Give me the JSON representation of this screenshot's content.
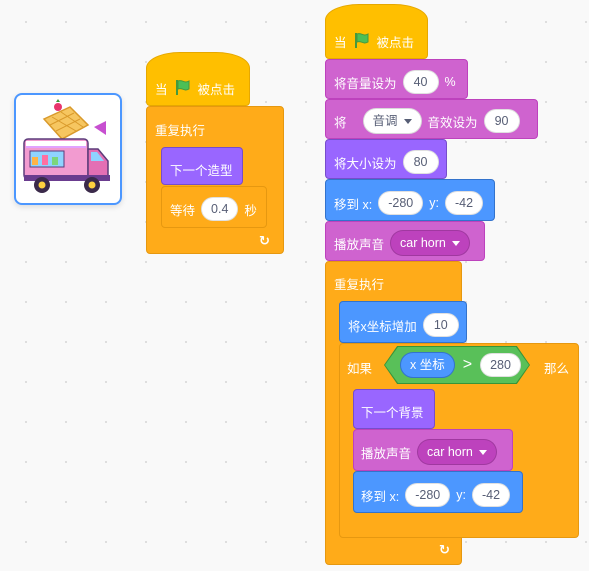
{
  "sprite": {
    "name_icon": "waffle-food-truck"
  },
  "script1": {
    "hat_when": "当",
    "hat_clicked": "被点击",
    "forever": "重复执行",
    "next_costume": "下一个造型",
    "wait_label": "等待",
    "wait_value": "0.4",
    "wait_unit": "秒"
  },
  "script2": {
    "hat_when": "当",
    "hat_clicked": "被点击",
    "set_volume_label": "将音量设为",
    "set_volume_value": "40",
    "set_volume_unit": "%",
    "set_effect_prefix": "将",
    "set_effect_option": "音调",
    "set_effect_label": "音效设为",
    "set_effect_value": "90",
    "set_size_label": "将大小设为",
    "set_size_value": "80",
    "goto_label": "移到 x:",
    "goto_x": "-280",
    "goto_y_label": "y:",
    "goto_y": "-42",
    "play_sound_label": "播放声音",
    "play_sound_option": "car horn",
    "forever": "重复执行",
    "change_x_label": "将x坐标增加",
    "change_x_value": "10",
    "if_label": "如果",
    "x_position": "x 坐标",
    "gt": ">",
    "compare_value": "280",
    "then_label": "那么",
    "next_backdrop": "下一个背景",
    "inner_play_sound_label": "播放声音",
    "inner_play_sound_option": "car horn",
    "inner_goto_label": "移到 x:",
    "inner_goto_x": "-280",
    "inner_goto_y_label": "y:",
    "inner_goto_y": "-42"
  },
  "colors": {
    "events": "#ffbf00",
    "control": "#ffab19",
    "looks": "#9966ff",
    "sound": "#cf63cf",
    "motion": "#4c97ff",
    "operators": "#59c059"
  }
}
